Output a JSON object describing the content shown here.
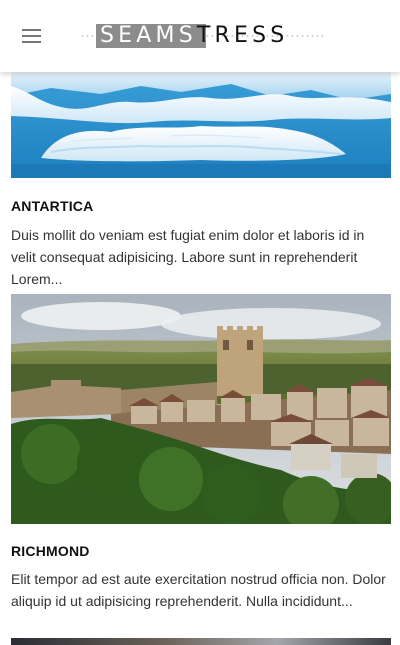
{
  "header": {
    "menu_icon": "hamburger-menu-icon",
    "logo": {
      "part_a": "SEAMS",
      "part_b": "TRESS"
    }
  },
  "feed": {
    "articles": [
      {
        "title": "ANTARTICA",
        "excerpt": "Duis mollit do veniam est fugiat enim dolor et laboris id in velit consequat adipisicing. Labore sunt in reprehenderit Lorem...",
        "image": "antarctic-iceberg-photo"
      },
      {
        "title": "RICHMOND",
        "excerpt": "Elit tempor ad est aute exercitation nostrud officia non. Dolor aliquip id ut adipisicing reprehenderit. Nulla incididunt...",
        "image": "richmond-town-castle-photo"
      },
      {
        "image": "next-article-photo"
      }
    ]
  }
}
